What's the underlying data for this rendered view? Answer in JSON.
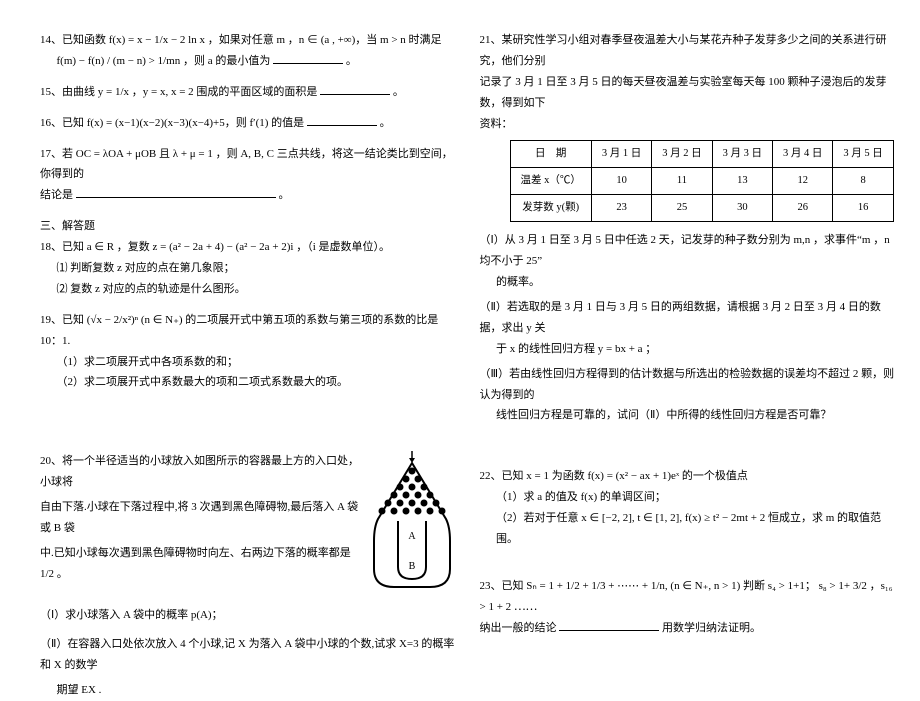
{
  "left": {
    "q14": {
      "line1": "14、已知函数 f(x) = x − 1/x − 2 ln x ，如果对任意 m ，n ∈ (a , +∞)，当 m > n 时满足",
      "line2": "f(m) − f(n) / (m − n) > 1/mn ，则 a 的最小值为",
      "line2_end": "。"
    },
    "q15": "15、由曲线 y = 1/x ，y = x, x = 2 围成的平面区域的面积是",
    "q15_end": "。",
    "q16": "16、已知 f(x) = (x−1)(x−2)(x−3)(x−4)+5，则 f′(1) 的值是",
    "q16_end": "。",
    "q17": {
      "line1": "17、若 OC = λOA + μOB 且 λ + μ = 1 ，则 A, B, C 三点共线，将这一结论类比到空间，你得到的",
      "line2": "结论是",
      "line2_end": "。"
    },
    "sec3": "三、解答题",
    "q18": {
      "line1": "18、已知 a ∈ R ，复数 z = (a² − 2a + 4) − (a² − 2a + 2)i ，（i 是虚数单位）。",
      "s1": "⑴ 判断复数 z 对应的点在第几象限；",
      "s2": "⑵ 复数 z 对应的点的轨迹是什么图形。"
    },
    "q19": {
      "line1": "19、已知 (√x − 2/x²)ⁿ (n ∈ N₊) 的二项展开式中第五项的系数与第三项的系数的比是 10：1.",
      "s1": "（1）求二项展开式中各项系数的和；",
      "s2": "（2）求二项展开式中系数最大的项和二项式系数最大的项。"
    },
    "q20": {
      "line1": "20、将一个半径适当的小球放入如图所示的容器最上方的入口处，小球将",
      "line2": "自由下落.小球在下落过程中,将 3 次遇到黑色障碍物,最后落入 A 袋或 B 袋",
      "line3": "中.已知小球每次遇到黑色障碍物时向左、右两边下落的概率都是 1/2 。",
      "pA": "（Ⅰ）求小球落入 A 袋中的概率 p(A)；",
      "pB": "（Ⅱ）在容器入口处依次放入 4 个小球,记 X 为落入 A 袋中小球的个数,试求 X=3 的概率和 X 的数学",
      "pB2": "期望 EX ."
    },
    "figure": {
      "labelA": "A",
      "labelB": "B"
    }
  },
  "right": {
    "q21": {
      "intro1": "21、某研究性学习小组对春季昼夜温差大小与某花卉种子发芽多少之间的关系进行研究，他们分别",
      "intro2": "记录了 3 月 1 日至 3 月 5 日的每天昼夜温差与实验室每天每 100 颗种子浸泡后的发芽数，得到如下",
      "intro3": "资料：",
      "table": {
        "h": [
          "日　期",
          "3 月 1 日",
          "3 月 2 日",
          "3 月 3 日",
          "3 月 4 日",
          "3 月 5 日"
        ],
        "r1": [
          "温差 x（℃）",
          "10",
          "11",
          "13",
          "12",
          "8"
        ],
        "r2": [
          "发芽数 y(颗)",
          "23",
          "25",
          "30",
          "26",
          "16"
        ]
      },
      "p1a": "（Ⅰ）从 3 月 1 日至 3 月 5 日中任选 2 天，记发芽的种子数分别为 m,n ，求事件“m ，n 均不小于 25”",
      "p1b": "的概率。",
      "p2a": "（Ⅱ）若选取的是 3 月 1 日与 3 月 5 日的两组数据，请根据 3 月 2 日至 3 月 4 日的数据，求出 y 关",
      "p2b": "于 x 的线性回归方程 y = bx + a ；",
      "p3a": "（Ⅲ）若由线性回归方程得到的估计数据与所选出的检验数据的误差均不超过 2 颗，则认为得到的",
      "p3b": "线性回归方程是可靠的，试问（Ⅱ）中所得的线性回归方程是否可靠？"
    },
    "q22": {
      "line1": "22、已知 x = 1 为函数 f(x) = (x² − ax + 1)eˣ 的一个极值点",
      "s1": "（1）求 a 的值及 f(x) 的单调区间；",
      "s2": "（2）若对于任意 x ∈ [−2, 2], t ∈ [1, 2], f(x) ≥ t² − 2mt + 2 恒成立，求 m 的取值范围。"
    },
    "q23": {
      "line1": "23、已知 Sₙ = 1 + 1/2 + 1/3 + ⋯⋯ + 1/n, (n ∈ N₊, n > 1) 判断 s₄ > 1+1；  s₈ > 1+ 3/2 ，s₁₆ > 1 + 2 ⋯⋯",
      "line2a": "纳出一般的结论",
      "line2b": "用数学归纳法证明。"
    }
  }
}
